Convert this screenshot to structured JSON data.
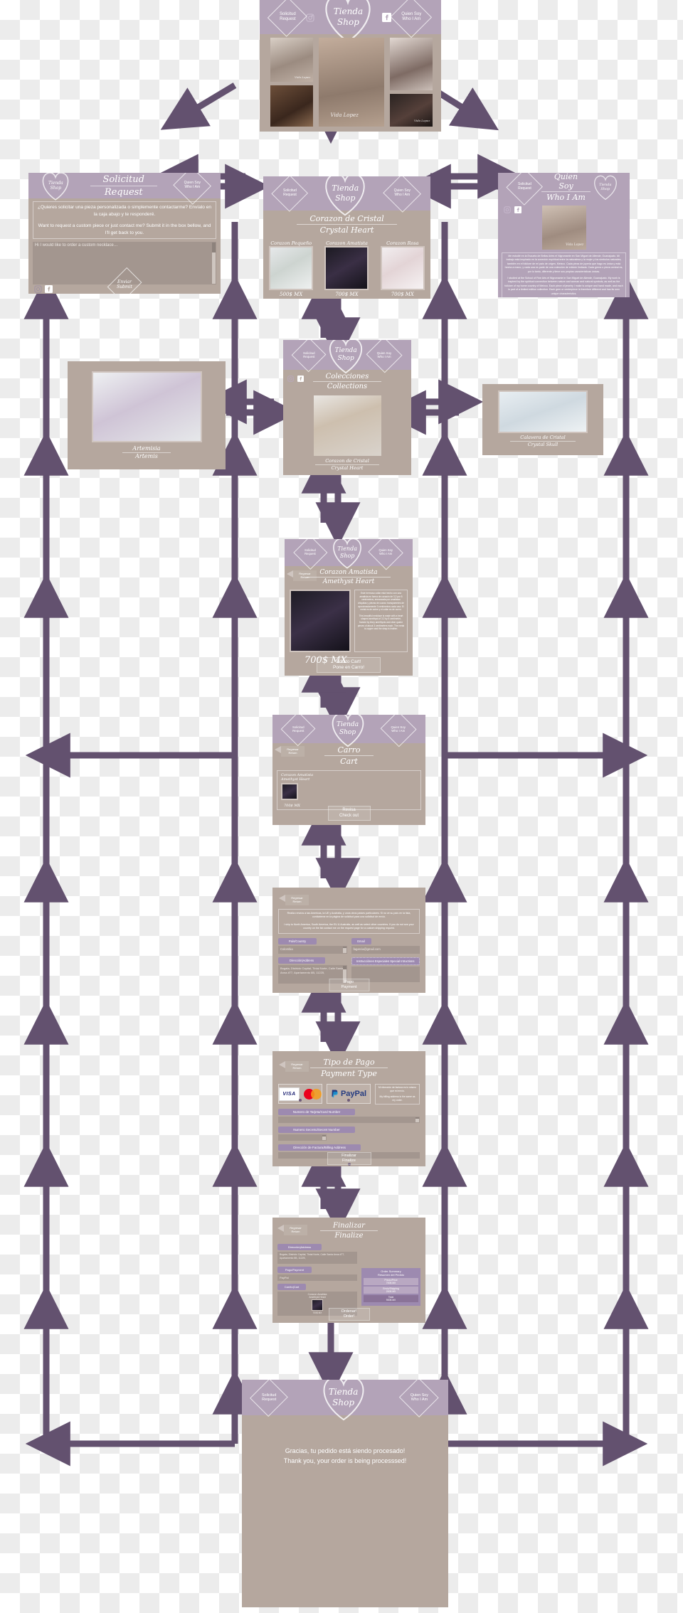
{
  "site": {
    "brand_es": "Tienda",
    "brand_en": "Shop",
    "nav_request_es": "Solicitud",
    "nav_request_en": "Request",
    "nav_about_es": "Quien Soy",
    "nav_about_en": "Who I Am",
    "back_es": "Regresar",
    "back_en": "Return",
    "instagram_icon": "instagram-icon",
    "facebook_icon": "facebook-icon",
    "colors": {
      "nav": "#b3a3b8",
      "card": "#b5a79e",
      "accent": "#6d5a78",
      "field_label": "#9d8ab0",
      "arrow": "#63516f"
    }
  },
  "home": {
    "name": "home-landing",
    "signature": "Vida Lopez",
    "photos": [
      {
        "alt": "portrait-model-1",
        "sig": "Vida Lopez"
      },
      {
        "alt": "portrait-model-2",
        "sig": ""
      },
      {
        "alt": "portrait-model-center",
        "sig": "Vida Lopez"
      },
      {
        "alt": "portrait-model-3",
        "sig": ""
      },
      {
        "alt": "portrait-model-4",
        "sig": "Vida Lopez"
      }
    ]
  },
  "request_page": {
    "title_es": "Solicitud",
    "title_en": "Request",
    "body_es": "¿Quieres solicitar una pieza personalizada o simplemente contactarme? Envíalo en la caja abajo y te responderé.",
    "body_en": "Want to request a custom piece or just contact me? Submit it in the box bellow, and I'll get back to you.",
    "textarea_value": "Hi I would like to order a custom necklace…",
    "submit_es": "Enviar",
    "submit_en": "Submit"
  },
  "about_page": {
    "title_es": "Quien Soy",
    "title_en": "Who I Am",
    "portrait_sig": "Vida Lopez",
    "body_es": "Me estudié en la Escuela de Bellas Artes el Nigromante en San Miguel de Allende, Guanajuato. Mi trabajo está inspirado en la conexión espiritual entre la naturaleza y la mujer y los símbolos naturales, también en el folklore de mi país de origen, Meixco. Cada pieza de joyería que hago es única y está hecha a mano, y cada una es parte de una colección de edición limitada. Cada gema o pieza central es, por lo tanto, diferente y tiene sus propias características únicas.",
    "body_en": "I studied at the School of Fine Arts el Nigromante in San Miguel de Allende, Guanajuato. My work is inspired by the spiritual connection between nature and woman and natural symbols, as well as the folklore of my home country of Meixco. Each piece of jewelry I make is unique and hand made, and each is part of a limited edition collection. Each gem or centerpiece is therefore different and has its own unique characteristics."
  },
  "crystal_heart_page": {
    "title_es": "Corazon de Cristal",
    "title_en": "Crystal Heart",
    "products": [
      {
        "name": "Corazon Pequeño",
        "price": "500$ MX",
        "img": "green-heart-pendant"
      },
      {
        "name": "Corazon Amatista",
        "price": "700$ MX",
        "img": "amethyst-heart-pendant"
      },
      {
        "name": "Corazon Rosa",
        "price": "700$ MX",
        "img": "rose-heart-pendant"
      }
    ]
  },
  "collections_page": {
    "title_es": "Colecciones",
    "title_en": "Collections",
    "caption_es": "Corazon de Cristal",
    "caption_en": "Crystal Heart",
    "img": "green-and-lilac-hearts"
  },
  "collection_artemis": {
    "caption_es": "Artemisia",
    "caption_en": "Artemis",
    "img": "amethyst-quartz-pendants"
  },
  "collection_skull": {
    "caption_es": "Calavera de Cristal",
    "caption_en": "Crystal Skull",
    "img": "crystal-skull-pendants"
  },
  "product_page": {
    "title_es": "Corazon Amatista",
    "title_en": "Amethyst Heart",
    "img": "amethyst-heart-necklace",
    "price": "700$ MX",
    "desc_es": "Este hermoso collar está hecho con una amatista en forma de corazón de 3,2 por 5 centímetros, enmarcada por amatistas chiquitas y piezas de cuarzo transparentes de aproximadamente 3 centímetros cada una. El metal es de cobre y el collar es de cuero.",
    "desc_en": "This beautiful necklace is made with a heart shaped amethyst of 3.2 by 5 centimeter, framed by tinny amethysts and clear quartz pieces of about 3 centimeters each. The metal is copper and the strap is leather.",
    "add_en": "Add to Cart!",
    "add_es": "Pone en Carro!"
  },
  "cart_page": {
    "title_es": "Carro",
    "title_en": "Cart",
    "item_name_es": "Corazon Amatista",
    "item_name_en": "Amethyst Heart",
    "item_price": "700$ MX",
    "checkout_es": "Revisa",
    "checkout_en": "Check out"
  },
  "shipping_page": {
    "notice_es": "Realizo envíos a las Americas, la UE y Australia, y unos otros países particulares. Si no ve su país en la lista, contácteme en la página de solicitud para una solicitud de envío.",
    "notice_en": "I ship to North America, South America, the EU & Australia, as well as select other countries. If you do not see your country on the list contact me on the request page for a custom shipping request.",
    "fields": [
      {
        "label": "País/Country",
        "value": "Colombia",
        "type": "select"
      },
      {
        "label": "Email",
        "value": "fagarcia@gmail.com",
        "type": "text"
      },
      {
        "label": "Dirección|Address",
        "value": "Bogata, Districto Capital, Tintal Norte, Calle Santa Anna #77, Apartamento 8B, 11225,",
        "type": "textarea"
      },
      {
        "label": "Instrucciónes Especiales\nSpecial Intructions",
        "value": "",
        "type": "textarea"
      }
    ],
    "next_es": "Pago",
    "next_en": "Payment"
  },
  "payment_page": {
    "title_es": "Tipo de Pago",
    "title_en": "Payment Type",
    "methods": [
      {
        "name": "card-visa-mastercard",
        "label": ""
      },
      {
        "name": "paypal",
        "label": "PayPal"
      }
    ],
    "billing_note_es": "Mi dirección de factura es lo mismo que mi envío.",
    "billing_note_en": "My billing address is the same as my order.",
    "fields": [
      {
        "label": "Numero de Tarjeta/Card Number",
        "value": ""
      },
      {
        "label": "Numero Secreto/Secret Number",
        "value": ""
      },
      {
        "label": "Dirección de Factura/Billing Address",
        "value": ""
      }
    ],
    "next_es": "Finalizar",
    "next_en": "Finalize"
  },
  "finalize_page": {
    "title_es": "Finalizar",
    "title_en": "Finalize",
    "labels": [
      "Dirección|Address",
      "Pago/Payment",
      "Carrito|Cart"
    ],
    "address_value": "Bogata, Districto Capital, Tintal Norte, Calle Santa Anna #77, Apartamento 8B, 11225,",
    "payment_value": "PayPal",
    "cart_item_es": "Corazon Amatista",
    "cart_item_en": "Amethyst Heart",
    "cart_item_price": "700$ MX",
    "summary_title_es": "Order Summary",
    "summary_title_en": "Resumen del Pedido",
    "summary_rows": [
      {
        "label": "Precio/Price",
        "value": "700$ MX"
      },
      {
        "label": "Envio/Shipping",
        "value": "200$ MX"
      },
      {
        "label": "Total",
        "value": "900$ MX"
      }
    ],
    "order_es": "Ordenar!",
    "order_en": "Order!"
  },
  "confirmation_page": {
    "message_es": "Gracias, tu pedido está siendo procesado!",
    "message_en": "Thank you, your order is being processsed!"
  }
}
